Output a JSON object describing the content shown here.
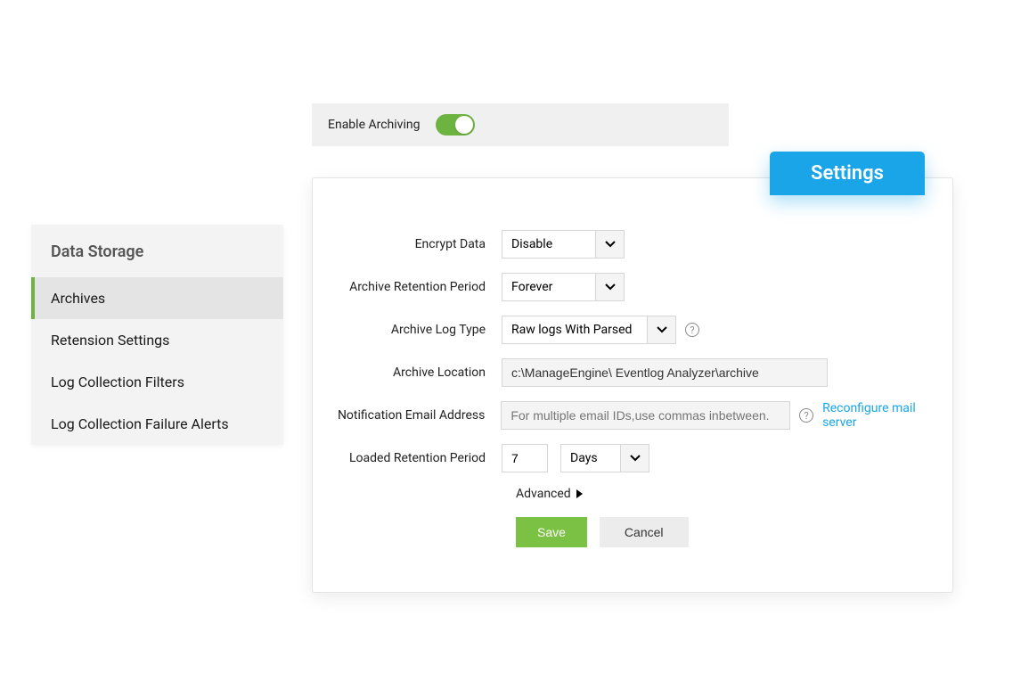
{
  "enable": {
    "label": "Enable Archiving",
    "on": true
  },
  "sidebar": {
    "title": "Data  Storage",
    "items": [
      {
        "label": "Archives",
        "active": true
      },
      {
        "label": "Retension Settings",
        "active": false
      },
      {
        "label": "Log Collection Filters",
        "active": false
      },
      {
        "label": "Log Collection Failure Alerts",
        "active": false
      }
    ]
  },
  "tab": {
    "label": "Settings"
  },
  "form": {
    "encrypt": {
      "label": "Encrypt Data",
      "value": "Disable"
    },
    "retention": {
      "label": "Archive Retention Period",
      "value": "Forever"
    },
    "logtype": {
      "label": "Archive Log Type",
      "value": "Raw logs With Parsed"
    },
    "location": {
      "label": "Archive Location",
      "value": "c:\\ManageEngine\\ Eventlog Analyzer\\archive"
    },
    "email": {
      "label": "Notification Email Address",
      "placeholder": "For multiple email IDs,use commas inbetween."
    },
    "loaded": {
      "label": "Loaded Retention Period",
      "value": "7",
      "unit_value": "Days"
    },
    "reconfigure_link": "Reconfigure mail server",
    "advanced_label": "Advanced",
    "save_label": "Save",
    "cancel_label": "Cancel"
  }
}
